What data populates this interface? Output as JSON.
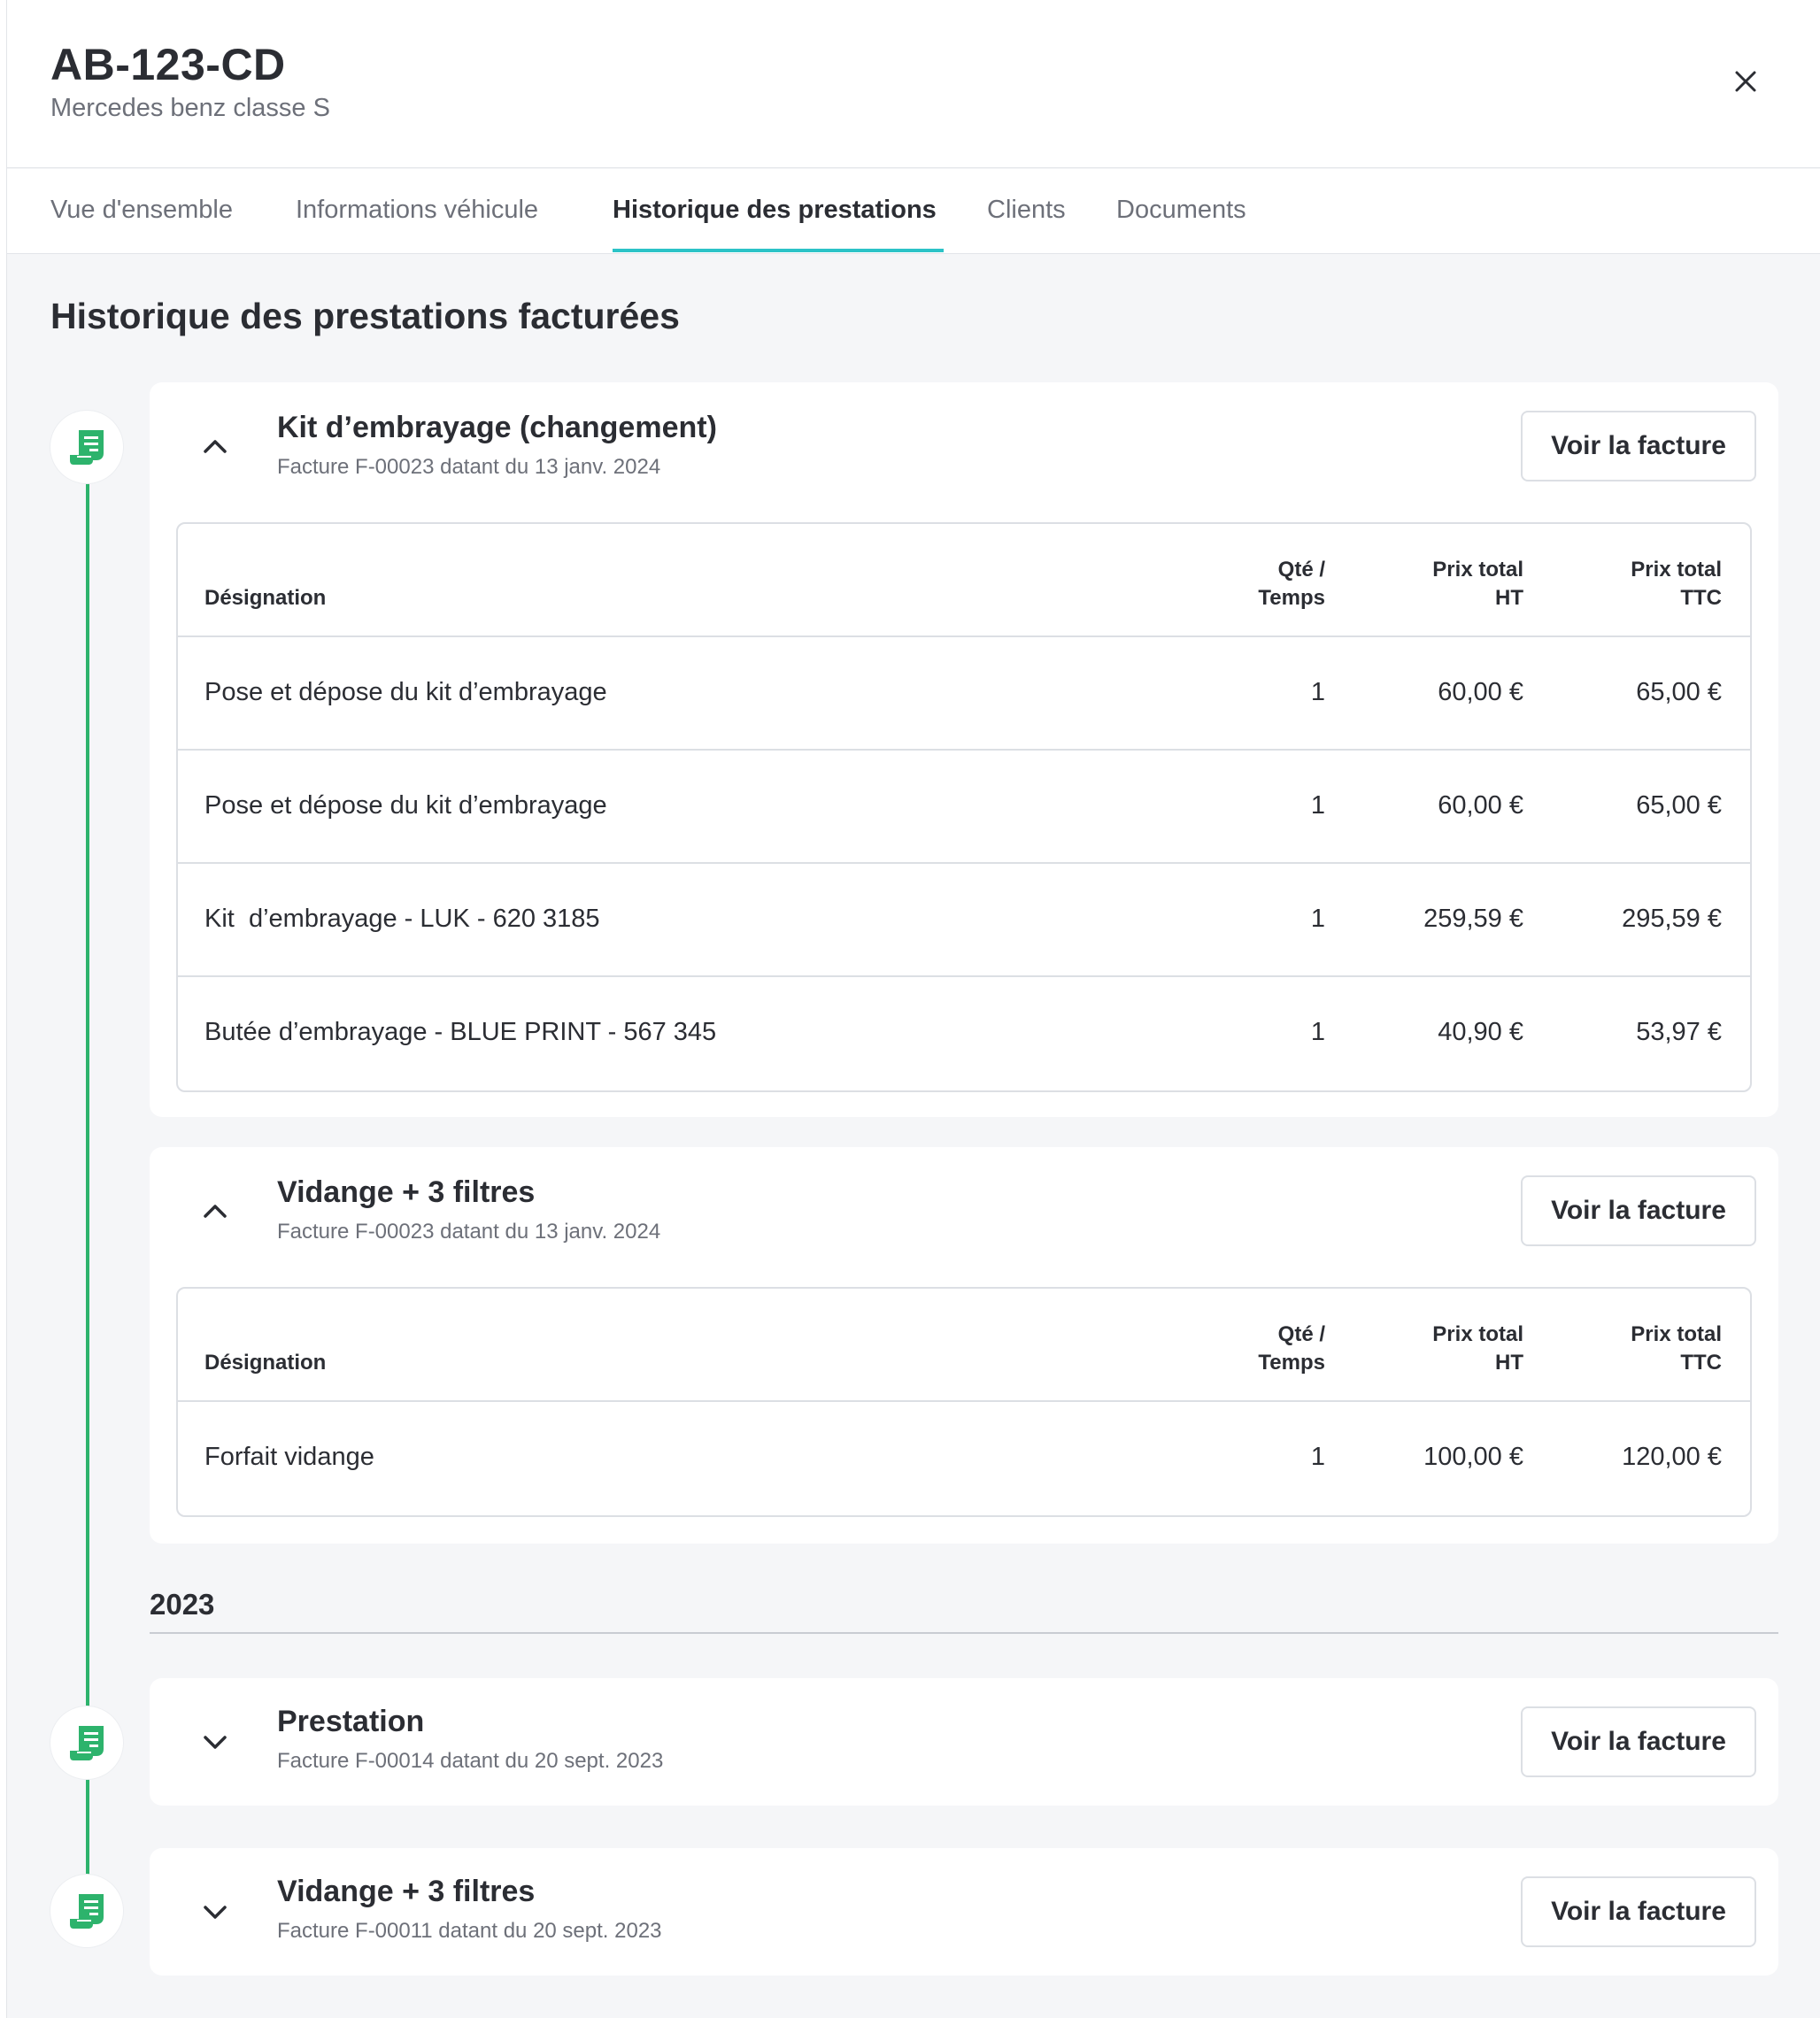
{
  "vehicle": {
    "plate": "AB-123-CD",
    "model": "Mercedes benz classe S"
  },
  "tabs": [
    {
      "label": "Vue d'ensemble"
    },
    {
      "label": "Informations véhicule"
    },
    {
      "label": "Historique des prestations",
      "active": true
    },
    {
      "label": "Clients"
    },
    {
      "label": "Documents"
    }
  ],
  "section_title": "Historique des prestations facturées",
  "table_headers": {
    "designation": "Désignation",
    "qty_line1": "Qté /",
    "qty_line2": "Temps",
    "ht_line1": "Prix total",
    "ht_line2": "HT",
    "ttc_line1": "Prix total",
    "ttc_line2": "TTC"
  },
  "view_invoice_label": "Voir la facture",
  "year_2023": "2023",
  "services": [
    {
      "title": "Kit d’embrayage (changement)",
      "subtitle": "Facture F-00023 datant du 13 janv. 2024",
      "expanded": true,
      "rows": [
        {
          "designation": "Pose et dépose du kit d’embrayage",
          "qty": "1",
          "ht": "60,00 €",
          "ttc": "65,00 €"
        },
        {
          "designation": "Pose et dépose du kit d’embrayage",
          "qty": "1",
          "ht": "60,00 €",
          "ttc": "65,00 €"
        },
        {
          "designation": "Kit  d’embrayage - LUK - 620 3185",
          "qty": "1",
          "ht": "259,59 €",
          "ttc": "295,59 €"
        },
        {
          "designation": "Butée d’embrayage - BLUE PRINT - 567 345",
          "qty": "1",
          "ht": "40,90 €",
          "ttc": "53,97 €"
        }
      ]
    },
    {
      "title": "Vidange + 3 filtres",
      "subtitle": "Facture F-00023 datant du 13 janv. 2024",
      "expanded": true,
      "rows": [
        {
          "designation": "Forfait vidange",
          "qty": "1",
          "ht": "100,00 €",
          "ttc": "120,00 €"
        }
      ]
    },
    {
      "title": "Prestation",
      "subtitle": "Facture F-00014 datant du 20 sept. 2023",
      "expanded": false
    },
    {
      "title": "Vidange + 3 filtres",
      "subtitle": "Facture F-00011 datant du 20 sept. 2023",
      "expanded": false
    }
  ],
  "colors": {
    "accent_tab": "#2cc3c7",
    "timeline_green": "#2db36c"
  },
  "icons": {
    "close": "close-icon",
    "collapse": "chevron-up-icon",
    "expand": "chevron-down-icon",
    "timeline": "invoice-icon"
  }
}
